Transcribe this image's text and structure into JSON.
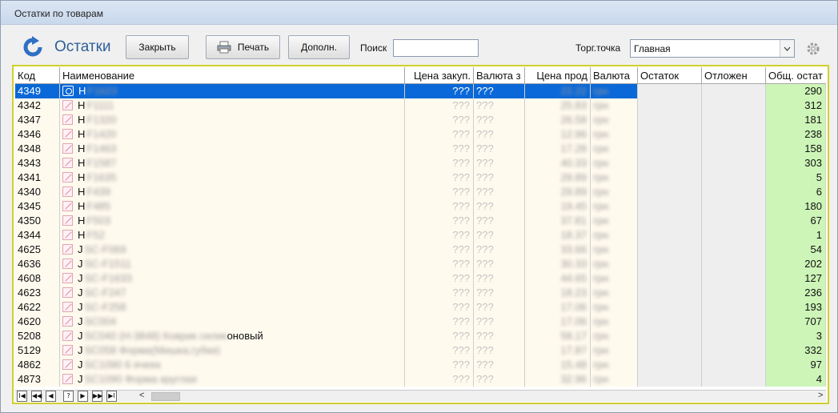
{
  "window": {
    "title": "Остатки по товарам"
  },
  "toolbar": {
    "title": "Остатки",
    "close_label": "Закрыть",
    "print_label": "Печать",
    "extra_label": "Дополн.",
    "search_label": "Поиск",
    "search_value": "",
    "outlet_label": "Торг.точка",
    "outlet_value": "Главная"
  },
  "grid": {
    "columns": [
      "Код",
      "Наименование",
      "Цена закуп.",
      "Валюта з",
      "Цена прод",
      "Валюта",
      "Остаток",
      "Отложен",
      "Общ. остат"
    ],
    "rows": [
      {
        "code": "4349",
        "name_prefix": "H",
        "name_hidden": "F1623",
        "purchase": "???",
        "pcur": "???",
        "sale": "22.22",
        "scur": "грн",
        "total": "290",
        "selected": true
      },
      {
        "code": "4342",
        "name_prefix": "H",
        "name_hidden": "F1111",
        "purchase": "???",
        "pcur": "???",
        "sale": "25.83",
        "scur": "грн",
        "total": "312"
      },
      {
        "code": "4347",
        "name_prefix": "H",
        "name_hidden": "F1320",
        "purchase": "???",
        "pcur": "???",
        "sale": "26.58",
        "scur": "грн",
        "total": "181"
      },
      {
        "code": "4346",
        "name_prefix": "H",
        "name_hidden": "F1420",
        "purchase": "???",
        "pcur": "???",
        "sale": "12.96",
        "scur": "грн",
        "total": "238"
      },
      {
        "code": "4348",
        "name_prefix": "H",
        "name_hidden": "F1463",
        "purchase": "???",
        "pcur": "???",
        "sale": "17.28",
        "scur": "грн",
        "total": "158"
      },
      {
        "code": "4343",
        "name_prefix": "H",
        "name_hidden": "F1587",
        "purchase": "???",
        "pcur": "???",
        "sale": "40.33",
        "scur": "грн",
        "total": "303"
      },
      {
        "code": "4341",
        "name_prefix": "H",
        "name_hidden": "F1635",
        "purchase": "???",
        "pcur": "???",
        "sale": "29.89",
        "scur": "грн",
        "total": "5"
      },
      {
        "code": "4340",
        "name_prefix": "H",
        "name_hidden": "F439",
        "purchase": "???",
        "pcur": "???",
        "sale": "29.89",
        "scur": "грн",
        "total": "6"
      },
      {
        "code": "4345",
        "name_prefix": "H",
        "name_hidden": "F485",
        "purchase": "???",
        "pcur": "???",
        "sale": "19.45",
        "scur": "грн",
        "total": "180"
      },
      {
        "code": "4350",
        "name_prefix": "H",
        "name_hidden": "F503",
        "purchase": "???",
        "pcur": "???",
        "sale": "37.81",
        "scur": "грн",
        "total": "67"
      },
      {
        "code": "4344",
        "name_prefix": "H",
        "name_hidden": "F52",
        "purchase": "???",
        "pcur": "???",
        "sale": "18.37",
        "scur": "грн",
        "total": "1"
      },
      {
        "code": "4625",
        "name_prefix": "J",
        "name_hidden": "SC-F069",
        "purchase": "???",
        "pcur": "???",
        "sale": "33.66",
        "scur": "грн",
        "total": "54"
      },
      {
        "code": "4636",
        "name_prefix": "J",
        "name_hidden": "SC-F1511",
        "purchase": "???",
        "pcur": "???",
        "sale": "30.33",
        "scur": "грн",
        "total": "202"
      },
      {
        "code": "4608",
        "name_prefix": "J",
        "name_hidden": "SC-F1633",
        "purchase": "???",
        "pcur": "???",
        "sale": "44.65",
        "scur": "грн",
        "total": "127"
      },
      {
        "code": "4623",
        "name_prefix": "J",
        "name_hidden": "SC-F247",
        "purchase": "???",
        "pcur": "???",
        "sale": "18.23",
        "scur": "грн",
        "total": "236"
      },
      {
        "code": "4622",
        "name_prefix": "J",
        "name_hidden": "SC-F258",
        "purchase": "???",
        "pcur": "???",
        "sale": "17.06",
        "scur": "грн",
        "total": "193"
      },
      {
        "code": "4620",
        "name_prefix": "J",
        "name_hidden": "SC004",
        "purchase": "???",
        "pcur": "???",
        "sale": "17.06",
        "scur": "грн",
        "total": "707"
      },
      {
        "code": "5208",
        "name_prefix": "J",
        "name_hidden": "SC040 (Н-3848) Коврик силик",
        "name_suffix": "оновый",
        "purchase": "???",
        "pcur": "???",
        "sale": "58.17",
        "scur": "грн",
        "total": "3"
      },
      {
        "code": "5129",
        "name_prefix": "J",
        "name_hidden": "SC058 Форма(Мишка,губки)",
        "purchase": "???",
        "pcur": "???",
        "sale": "17.87",
        "scur": "грн",
        "total": "332"
      },
      {
        "code": "4862",
        "name_prefix": "J",
        "name_hidden": "SC1090 6 ячеек",
        "purchase": "???",
        "pcur": "???",
        "sale": "15.48",
        "scur": "грн",
        "total": "97"
      },
      {
        "code": "4873",
        "name_prefix": "J",
        "name_hidden": "SC1090 Форма круглая",
        "purchase": "???",
        "pcur": "???",
        "sale": "32.96",
        "scur": "грн",
        "total": "4"
      }
    ]
  },
  "nav": {
    "first": "I◀",
    "prev_page": "◀◀",
    "prev": "◀",
    "find": "?",
    "next": "▶",
    "next_page": "▶▶",
    "last": "▶I"
  },
  "colors": {
    "accent": "#2f5f97",
    "selection": "#0a68d8",
    "row_bg": "#fffaee",
    "qty_bg": "#eeeeee",
    "total_bg": "#cdf5b8",
    "frame": "#d2cf2e"
  }
}
